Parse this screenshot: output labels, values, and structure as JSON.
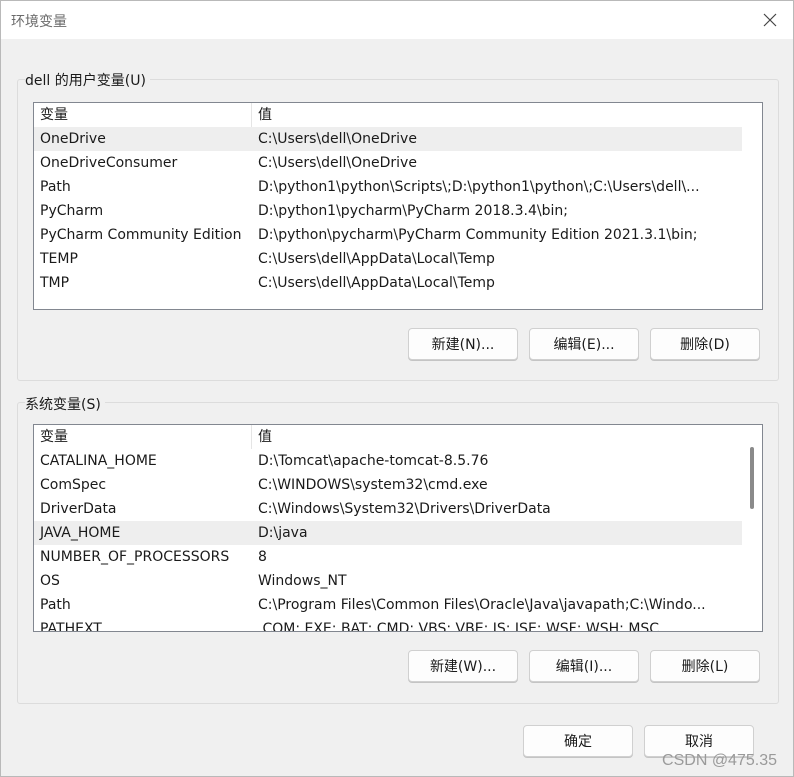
{
  "window": {
    "title": "环境变量",
    "close_icon": "close-icon"
  },
  "user_vars": {
    "group_label": "dell 的用户变量(U)",
    "headers": {
      "name": "变量",
      "value": "值"
    },
    "rows": [
      {
        "name": "OneDrive",
        "value": "C:\\Users\\dell\\OneDrive",
        "selected": true
      },
      {
        "name": "OneDriveConsumer",
        "value": "C:\\Users\\dell\\OneDrive"
      },
      {
        "name": "Path",
        "value": "D:\\python1\\python\\Scripts\\;D:\\python1\\python\\;C:\\Users\\dell\\..."
      },
      {
        "name": "PyCharm",
        "value": "D:\\python1\\pycharm\\PyCharm 2018.3.4\\bin;"
      },
      {
        "name": "PyCharm Community Edition",
        "value": "D:\\python\\pycharm\\PyCharm Community Edition 2021.3.1\\bin;"
      },
      {
        "name": "TEMP",
        "value": "C:\\Users\\dell\\AppData\\Local\\Temp"
      },
      {
        "name": "TMP",
        "value": "C:\\Users\\dell\\AppData\\Local\\Temp"
      }
    ],
    "buttons": {
      "new": "新建(N)...",
      "edit": "编辑(E)...",
      "delete": "删除(D)"
    }
  },
  "system_vars": {
    "group_label": "系统变量(S)",
    "headers": {
      "name": "变量",
      "value": "值"
    },
    "rows": [
      {
        "name": "CATALINA_HOME",
        "value": "D:\\Tomcat\\apache-tomcat-8.5.76"
      },
      {
        "name": "ComSpec",
        "value": "C:\\WINDOWS\\system32\\cmd.exe"
      },
      {
        "name": "DriverData",
        "value": "C:\\Windows\\System32\\Drivers\\DriverData"
      },
      {
        "name": "JAVA_HOME",
        "value": "D:\\java",
        "selected": true
      },
      {
        "name": "NUMBER_OF_PROCESSORS",
        "value": "8"
      },
      {
        "name": "OS",
        "value": "Windows_NT"
      },
      {
        "name": "Path",
        "value": "C:\\Program Files\\Common Files\\Oracle\\Java\\javapath;C:\\Windo..."
      },
      {
        "name": "PATHEXT",
        "value": ".COM;.EXE;.BAT;.CMD;.VBS;.VBE;.JS;.JSE;.WSF;.WSH;.MSC"
      }
    ],
    "buttons": {
      "new": "新建(W)...",
      "edit": "编辑(I)...",
      "delete": "删除(L)"
    }
  },
  "footer": {
    "ok": "确定",
    "cancel": "取消"
  },
  "watermark": "CSDN @475.35"
}
